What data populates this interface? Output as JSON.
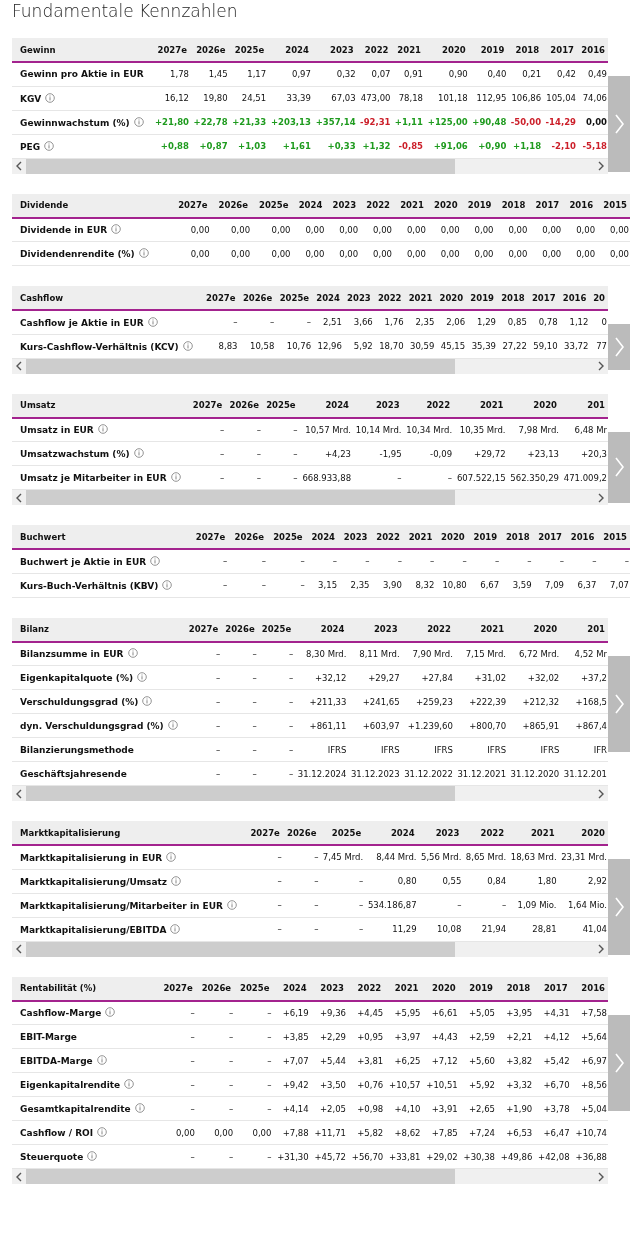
{
  "title": "Fundamentale Kennzahlen",
  "sections": [
    {
      "title": "Gewinn",
      "scrollable": true,
      "columns": [
        "2027e",
        "2026e",
        "2025e",
        "2024",
        "2023",
        "2022",
        "2021",
        "2020",
        "2019",
        "2018",
        "2017",
        "2016"
      ],
      "rows": [
        {
          "label": "Gewinn pro Aktie in EUR",
          "info": false,
          "cells": [
            "1,78",
            "1,45",
            "1,17",
            "0,97",
            "0,32",
            "0,07",
            "0,91",
            "0,90",
            "0,40",
            "0,21",
            "0,42",
            "0,49"
          ]
        },
        {
          "label": "KGV",
          "info": true,
          "cells": [
            "16,12",
            "19,80",
            "24,51",
            "33,39",
            "67,03",
            "473,00",
            "78,18",
            "101,18",
            "112,95",
            "106,86",
            "105,04",
            "74,06"
          ]
        },
        {
          "label": "Gewinnwachstum (%)",
          "info": true,
          "cells": [
            {
              "value": "+21,80",
              "color": "#1f9b1f"
            },
            {
              "value": "+22,78",
              "color": "#1f9b1f"
            },
            {
              "value": "+21,33",
              "color": "#1f9b1f"
            },
            {
              "value": "+203,13",
              "color": "#1f9b1f"
            },
            {
              "value": "+357,14",
              "color": "#1f9b1f"
            },
            {
              "value": "-92,31",
              "color": "#cc1f2a"
            },
            {
              "value": "+1,11",
              "color": "#1f9b1f"
            },
            {
              "value": "+125,00",
              "color": "#1f9b1f"
            },
            {
              "value": "+90,48",
              "color": "#1f9b1f"
            },
            {
              "value": "-50,00",
              "color": "#cc1f2a"
            },
            {
              "value": "-14,29",
              "color": "#cc1f2a"
            },
            {
              "value": "0,00",
              "color": "#111111"
            }
          ]
        },
        {
          "label": "PEG",
          "info": true,
          "cells": [
            {
              "value": "+0,88",
              "color": "#1f9b1f"
            },
            {
              "value": "+0,87",
              "color": "#1f9b1f"
            },
            {
              "value": "+1,03",
              "color": "#1f9b1f"
            },
            {
              "value": "+1,61",
              "color": "#1f9b1f"
            },
            {
              "value": "+0,33",
              "color": "#1f9b1f"
            },
            {
              "value": "+1,32",
              "color": "#1f9b1f"
            },
            {
              "value": "-0,85",
              "color": "#cc1f2a"
            },
            {
              "value": "+91,06",
              "color": "#1f9b1f"
            },
            {
              "value": "+0,90",
              "color": "#1f9b1f"
            },
            {
              "value": "+1,18",
              "color": "#1f9b1f"
            },
            {
              "value": "-2,10",
              "color": "#cc1f2a"
            },
            {
              "value": "-5,18",
              "color": "#cc1f2a"
            }
          ]
        }
      ]
    },
    {
      "title": "Dividende",
      "scrollable": false,
      "columns": [
        "2027e",
        "2026e",
        "2025e",
        "2024",
        "2023",
        "2022",
        "2021",
        "2020",
        "2019",
        "2018",
        "2017",
        "2016",
        "2015"
      ],
      "rows": [
        {
          "label": "Dividende in EUR",
          "info": true,
          "cells": [
            "0,00",
            "0,00",
            "0,00",
            "0,00",
            "0,00",
            "0,00",
            "0,00",
            "0,00",
            "0,00",
            "0,00",
            "0,00",
            "0,00",
            "0,00"
          ]
        },
        {
          "label": "Dividendenrendite (%)",
          "info": true,
          "cells": [
            "0,00",
            "0,00",
            "0,00",
            "0,00",
            "0,00",
            "0,00",
            "0,00",
            "0,00",
            "0,00",
            "0,00",
            "0,00",
            "0,00",
            "0,00"
          ]
        }
      ]
    },
    {
      "title": "Cashflow",
      "scrollable": true,
      "columns": [
        "2027e",
        "2026e",
        "2025e",
        "2024",
        "2023",
        "2022",
        "2021",
        "2020",
        "2019",
        "2018",
        "2017",
        "2016",
        "20"
      ],
      "rows": [
        {
          "label": "Cashflow je Aktie in EUR",
          "info": true,
          "cells": [
            "–",
            "–",
            "–",
            "2,51",
            "3,66",
            "1,76",
            "2,35",
            "2,06",
            "1,29",
            "0,85",
            "0,78",
            "1,12",
            "0"
          ]
        },
        {
          "label": "Kurs-Cashflow-Verhältnis (KCV)",
          "info": true,
          "cells": [
            "8,83",
            "10,58",
            "10,76",
            "12,96",
            "5,92",
            "18,70",
            "30,59",
            "45,15",
            "35,39",
            "27,22",
            "59,10",
            "33,72",
            "77"
          ]
        }
      ]
    },
    {
      "title": "Umsatz",
      "scrollable": true,
      "columns": [
        "2027e",
        "2026e",
        "2025e",
        "2024",
        "2023",
        "2022",
        "2021",
        "2020",
        "201"
      ],
      "rows": [
        {
          "label": "Umsatz in EUR",
          "info": true,
          "cells": [
            "–",
            "–",
            "–",
            "10,57 Mrd.",
            "10,14 Mrd.",
            "10,34 Mrd.",
            "10,35 Mrd.",
            "7,98 Mrd.",
            "6,48 Mr"
          ]
        },
        {
          "label": "Umsatzwachstum (%)",
          "info": true,
          "cells": [
            "–",
            "–",
            "–",
            "+4,23",
            "-1,95",
            "-0,09",
            "+29,72",
            "+23,13",
            "+20,3"
          ]
        },
        {
          "label": "Umsatz je Mitarbeiter in EUR",
          "info": true,
          "cells": [
            "–",
            "–",
            "–",
            "668.933,88",
            "–",
            "–",
            "607.522,15",
            "562.350,29",
            "471.009,2"
          ]
        }
      ]
    },
    {
      "title": "Buchwert",
      "scrollable": false,
      "columns": [
        "2027e",
        "2026e",
        "2025e",
        "2024",
        "2023",
        "2022",
        "2021",
        "2020",
        "2019",
        "2018",
        "2017",
        "2016",
        "2015"
      ],
      "rows": [
        {
          "label": "Buchwert je Aktie in EUR",
          "info": true,
          "cells": [
            "–",
            "–",
            "–",
            "–",
            "–",
            "–",
            "–",
            "–",
            "–",
            "–",
            "–",
            "–",
            "–"
          ]
        },
        {
          "label": "Kurs-Buch-Verhältnis (KBV)",
          "info": true,
          "cells": [
            "–",
            "–",
            "–",
            "3,15",
            "2,35",
            "3,90",
            "8,32",
            "10,80",
            "6,67",
            "3,59",
            "7,09",
            "6,37",
            "7,07"
          ]
        }
      ]
    },
    {
      "title": "Bilanz",
      "scrollable": true,
      "columns": [
        "2027e",
        "2026e",
        "2025e",
        "2024",
        "2023",
        "2022",
        "2021",
        "2020",
        "201"
      ],
      "rows": [
        {
          "label": "Bilanzsumme in EUR",
          "info": true,
          "cells": [
            "–",
            "–",
            "–",
            "8,30 Mrd.",
            "8,11 Mrd.",
            "7,90 Mrd.",
            "7,15 Mrd.",
            "6,72 Mrd.",
            "4,52 Mr"
          ]
        },
        {
          "label": "Eigenkapitalquote (%)",
          "info": true,
          "cells": [
            "–",
            "–",
            "–",
            "+32,12",
            "+29,27",
            "+27,84",
            "+31,02",
            "+32,02",
            "+37,2"
          ]
        },
        {
          "label": "Verschuldungsgrad (%)",
          "info": true,
          "cells": [
            "–",
            "–",
            "–",
            "+211,33",
            "+241,65",
            "+259,23",
            "+222,39",
            "+212,32",
            "+168,5"
          ]
        },
        {
          "label": "dyn. Verschuldungsgrad (%)",
          "info": true,
          "cells": [
            "–",
            "–",
            "–",
            "+861,11",
            "+603,97",
            "+1.239,60",
            "+800,70",
            "+865,91",
            "+867,4"
          ]
        },
        {
          "label": "Bilanzierungsmethode",
          "info": false,
          "cells": [
            "–",
            "–",
            "–",
            "IFRS",
            "IFRS",
            "IFRS",
            "IFRS",
            "IFRS",
            "IFR"
          ]
        },
        {
          "label": "Geschäftsjahresende",
          "info": false,
          "cells": [
            "–",
            "–",
            "–",
            "31.12.2024",
            "31.12.2023",
            "31.12.2022",
            "31.12.2021",
            "31.12.2020",
            "31.12.201"
          ]
        }
      ]
    },
    {
      "title": "Marktkapitalisierung",
      "scrollable": true,
      "columns": [
        "2027e",
        "2026e",
        "2025e",
        "2024",
        "2023",
        "2022",
        "2021",
        "2020"
      ],
      "rows": [
        {
          "label": "Marktkapitalisierung in EUR",
          "info": true,
          "cells": [
            "–",
            "–",
            "7,45 Mrd.",
            "8,44 Mrd.",
            "5,56 Mrd.",
            "8,65 Mrd.",
            "18,63 Mrd.",
            "23,31 Mrd."
          ]
        },
        {
          "label": "Marktkapitalisierung/Umsatz",
          "info": true,
          "cells": [
            "–",
            "–",
            "–",
            "0,80",
            "0,55",
            "0,84",
            "1,80",
            "2,92"
          ]
        },
        {
          "label": "Marktkapitalisierung/Mitarbeiter in EUR",
          "info": true,
          "cells": [
            "–",
            "–",
            "–",
            "534.186,87",
            "–",
            "–",
            "1,09 Mio.",
            "1,64 Mio."
          ]
        },
        {
          "label": "Marktkapitalisierung/EBITDA",
          "info": true,
          "cells": [
            "–",
            "–",
            "–",
            "11,29",
            "10,08",
            "21,94",
            "28,81",
            "41,04"
          ]
        }
      ]
    },
    {
      "title": "Rentabilität (%)",
      "scrollable": true,
      "columns": [
        "2027e",
        "2026e",
        "2025e",
        "2024",
        "2023",
        "2022",
        "2021",
        "2020",
        "2019",
        "2018",
        "2017",
        "2016"
      ],
      "rows": [
        {
          "label": "Cashflow-Marge",
          "info": true,
          "cells": [
            "–",
            "–",
            "–",
            "+6,19",
            "+9,36",
            "+4,45",
            "+5,95",
            "+6,61",
            "+5,05",
            "+3,95",
            "+4,31",
            "+7,58"
          ]
        },
        {
          "label": "EBIT-Marge",
          "info": false,
          "cells": [
            "–",
            "–",
            "–",
            "+3,85",
            "+2,29",
            "+0,95",
            "+3,97",
            "+4,43",
            "+2,59",
            "+2,21",
            "+4,12",
            "+5,64"
          ]
        },
        {
          "label": "EBITDA-Marge",
          "info": true,
          "cells": [
            "–",
            "–",
            "–",
            "+7,07",
            "+5,44",
            "+3,81",
            "+6,25",
            "+7,12",
            "+5,60",
            "+3,82",
            "+5,42",
            "+6,97"
          ]
        },
        {
          "label": "Eigenkapitalrendite",
          "info": true,
          "cells": [
            "–",
            "–",
            "–",
            "+9,42",
            "+3,50",
            "+0,76",
            "+10,57",
            "+10,51",
            "+5,92",
            "+3,32",
            "+6,70",
            "+8,56"
          ]
        },
        {
          "label": "Gesamtkapitalrendite",
          "info": true,
          "cells": [
            "–",
            "–",
            "–",
            "+4,14",
            "+2,05",
            "+0,98",
            "+4,10",
            "+3,91",
            "+2,65",
            "+1,90",
            "+3,78",
            "+5,04"
          ]
        },
        {
          "label": "Cashflow / ROI",
          "info": true,
          "cells": [
            "0,00",
            "0,00",
            "0,00",
            "+7,88",
            "+11,71",
            "+5,82",
            "+8,62",
            "+7,85",
            "+7,24",
            "+6,53",
            "+6,47",
            "+10,74"
          ]
        },
        {
          "label": "Steuerquote",
          "info": true,
          "cells": [
            "–",
            "–",
            "–",
            "+31,30",
            "+45,72",
            "+56,70",
            "+33,81",
            "+29,02",
            "+30,38",
            "+49,86",
            "+42,08",
            "+36,88"
          ]
        }
      ]
    }
  ]
}
